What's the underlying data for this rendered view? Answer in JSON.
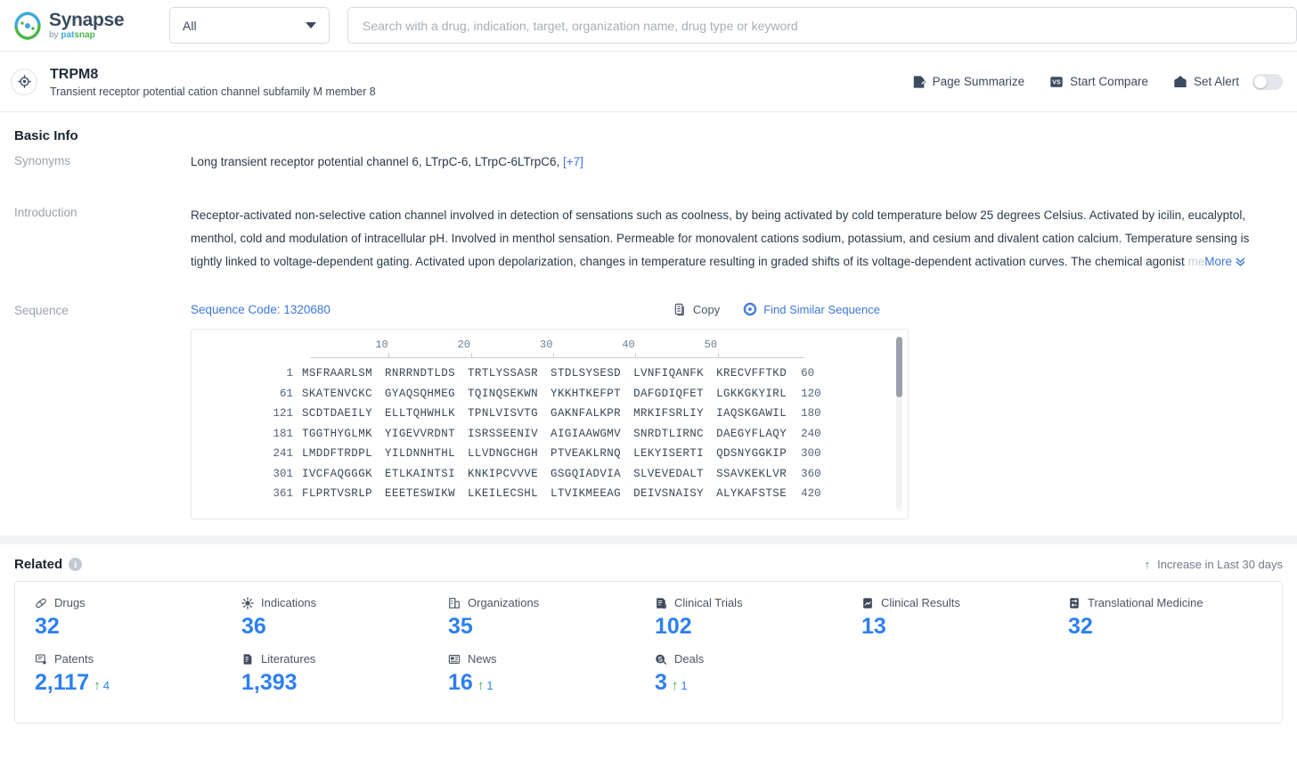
{
  "topbar": {
    "logo_title": "Synapse",
    "logo_by": "by ",
    "logo_pat": "pat",
    "logo_snap": "snap",
    "scope_value": "All",
    "search_placeholder": "Search with a drug, indication, target, organization name, drug type or keyword"
  },
  "entity": {
    "icon": "target-icon",
    "name": "TRPM8",
    "description": "Transient receptor potential cation channel subfamily M member 8",
    "actions": [
      {
        "icon": "page-summarize-icon",
        "label": "Page Summarize"
      },
      {
        "icon": "vs-compare-icon",
        "label": "Start Compare"
      },
      {
        "icon": "alert-bell-icon",
        "label": "Set Alert"
      }
    ],
    "alert_toggle_on": false
  },
  "basic_info": {
    "title": "Basic Info",
    "synonyms_label": "Synonyms",
    "synonyms_value": "Long transient receptor potential channel 6,  LTrpC-6,  LTrpC-6LTrpC6,",
    "synonyms_more": "[+7]",
    "introduction_label": "Introduction",
    "introduction_text": "Receptor-activated non-selective cation channel involved in detection of sensations such as coolness, by being activated by cold temperature below 25 degrees Celsius. Activated by icilin, eucalyptol, menthol, cold and modulation of intracellular pH. Involved in menthol sensation. Permeable for monovalent cations sodium, potassium, and cesium and divalent cation calcium. Temperature sensing is tightly linked to voltage-dependent gating. Activated upon depolarization, changes in temperature resulting in graded shifts of its voltage-dependent activation curves. The chemical agonist ",
    "introduction_faded": "me",
    "introduction_more": "More"
  },
  "sequence": {
    "label": "Sequence",
    "code_label": "Sequence Code: 1320680",
    "copy_label": "Copy",
    "find_similar_label": "Find Similar Sequence",
    "ruler_ticks": [
      10,
      20,
      30,
      40,
      50
    ],
    "rows": [
      {
        "start": "1",
        "chunks": [
          "MSFRAARLSM",
          "RNRRNDTLDS",
          "TRTLYSSASR",
          "STDLSYSESD",
          "LVNFIQANFK",
          "KRECVFFTKD"
        ],
        "end": "60"
      },
      {
        "start": "61",
        "chunks": [
          "SKATENVCKC",
          "GYAQSQHMEG",
          "TQINQSEKWN",
          "YKKHTKEFPT",
          "DAFGDIQFET",
          "LGKKGKYIRL"
        ],
        "end": "120"
      },
      {
        "start": "121",
        "chunks": [
          "SCDTDAEILY",
          "ELLTQHWHLK",
          "TPNLVISVTG",
          "GAKNFALKPR",
          "MRKIFSRLIY",
          "IAQSKGAWIL"
        ],
        "end": "180"
      },
      {
        "start": "181",
        "chunks": [
          "TGGTHYGLMK",
          "YIGEVVRDNT",
          "ISRSSEENIV",
          "AIGIAAWGMV",
          "SNRDTLIRNC",
          "DAEGYFLAQY"
        ],
        "end": "240"
      },
      {
        "start": "241",
        "chunks": [
          "LMDDFTRDPL",
          "YILDNNHTHL",
          "LLVDNGCHGH",
          "PTVEAKLRNQ",
          "LEKYISERTI",
          "QDSNYGGKIP"
        ],
        "end": "300"
      },
      {
        "start": "301",
        "chunks": [
          "IVCFAQGGGK",
          "ETLKAINTSI",
          "KNKIPCVVVE",
          "GSGQIADVIA",
          "SLVEVEDALT",
          "SSAVKEKLVR"
        ],
        "end": "360"
      },
      {
        "start": "361",
        "chunks": [
          "FLPRTVSRLP",
          "EEETESWIKW",
          "LKEILECSHL",
          "LTVIKMEEAG",
          "DEIVSNAISY",
          "ALYKAFSTSE"
        ],
        "end": "420"
      }
    ]
  },
  "related": {
    "title": "Related",
    "info_glyph": "i",
    "legend_label": "Increase in Last 30 days",
    "legend_arrow": "↑",
    "stats": [
      {
        "icon": "drugs-icon",
        "label": "Drugs",
        "value": "32",
        "delta": null
      },
      {
        "icon": "indications-icon",
        "label": "Indications",
        "value": "36",
        "delta": null
      },
      {
        "icon": "organizations-icon",
        "label": "Organizations",
        "value": "35",
        "delta": null
      },
      {
        "icon": "clinical-trials-icon",
        "label": "Clinical Trials",
        "value": "102",
        "delta": null
      },
      {
        "icon": "clinical-results-icon",
        "label": "Clinical Results",
        "value": "13",
        "delta": null
      },
      {
        "icon": "translational-medicine-icon",
        "label": "Translational Medicine",
        "value": "32",
        "delta": null
      },
      {
        "icon": "patents-icon",
        "label": "Patents",
        "value": "2,117",
        "delta": "4"
      },
      {
        "icon": "literatures-icon",
        "label": "Literatures",
        "value": "1,393",
        "delta": null
      },
      {
        "icon": "news-icon",
        "label": "News",
        "value": "16",
        "delta": "1"
      },
      {
        "icon": "deals-icon",
        "label": "Deals",
        "value": "3",
        "delta": "1"
      }
    ]
  },
  "colors": {
    "accent_blue": "#2d7ff0",
    "link_blue": "#3c78d8",
    "increase_green": "#35a84c",
    "text_dark": "#2b3a4a",
    "muted": "#9aa3ad"
  }
}
